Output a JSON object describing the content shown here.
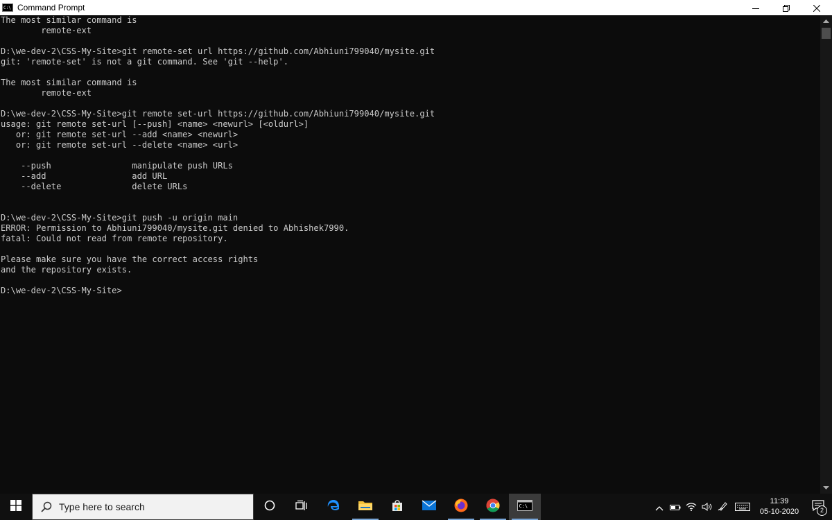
{
  "window": {
    "title": "Command Prompt",
    "minimize_icon": "minimize-icon",
    "maximize_icon": "restore-icon",
    "close_icon": "close-icon"
  },
  "console": {
    "lines": [
      "The most similar command is",
      "        remote-ext",
      "",
      "D:\\we-dev-2\\CSS-My-Site>git remote-set url https://github.com/Abhiuni799040/mysite.git",
      "git: 'remote-set' is not a git command. See 'git --help'.",
      "",
      "The most similar command is",
      "        remote-ext",
      "",
      "D:\\we-dev-2\\CSS-My-Site>git remote set-url https://github.com/Abhiuni799040/mysite.git",
      "usage: git remote set-url [--push] <name> <newurl> [<oldurl>]",
      "   or: git remote set-url --add <name> <newurl>",
      "   or: git remote set-url --delete <name> <url>",
      "",
      "    --push                manipulate push URLs",
      "    --add                 add URL",
      "    --delete              delete URLs",
      "",
      "",
      "D:\\we-dev-2\\CSS-My-Site>git push -u origin main",
      "ERROR: Permission to Abhiuni799040/mysite.git denied to Abhishek7990.",
      "fatal: Could not read from remote repository.",
      "",
      "Please make sure you have the correct access rights",
      "and the repository exists.",
      "",
      "D:\\we-dev-2\\CSS-My-Site>"
    ]
  },
  "taskbar": {
    "search_placeholder": "Type here to search",
    "apps": [
      "cortana-icon",
      "task-view-icon",
      "edge-icon",
      "file-explorer-icon",
      "store-icon",
      "mail-icon",
      "firefox-icon",
      "chrome-icon",
      "command-prompt-icon"
    ],
    "clock_time": "11:39",
    "clock_date": "05-10-2020",
    "notification_count": "2"
  },
  "colors": {
    "console_bg": "#0c0c0c",
    "console_text": "#cccccc",
    "taskbar_bg": "#101010",
    "titlebar_bg": "#ffffff"
  }
}
